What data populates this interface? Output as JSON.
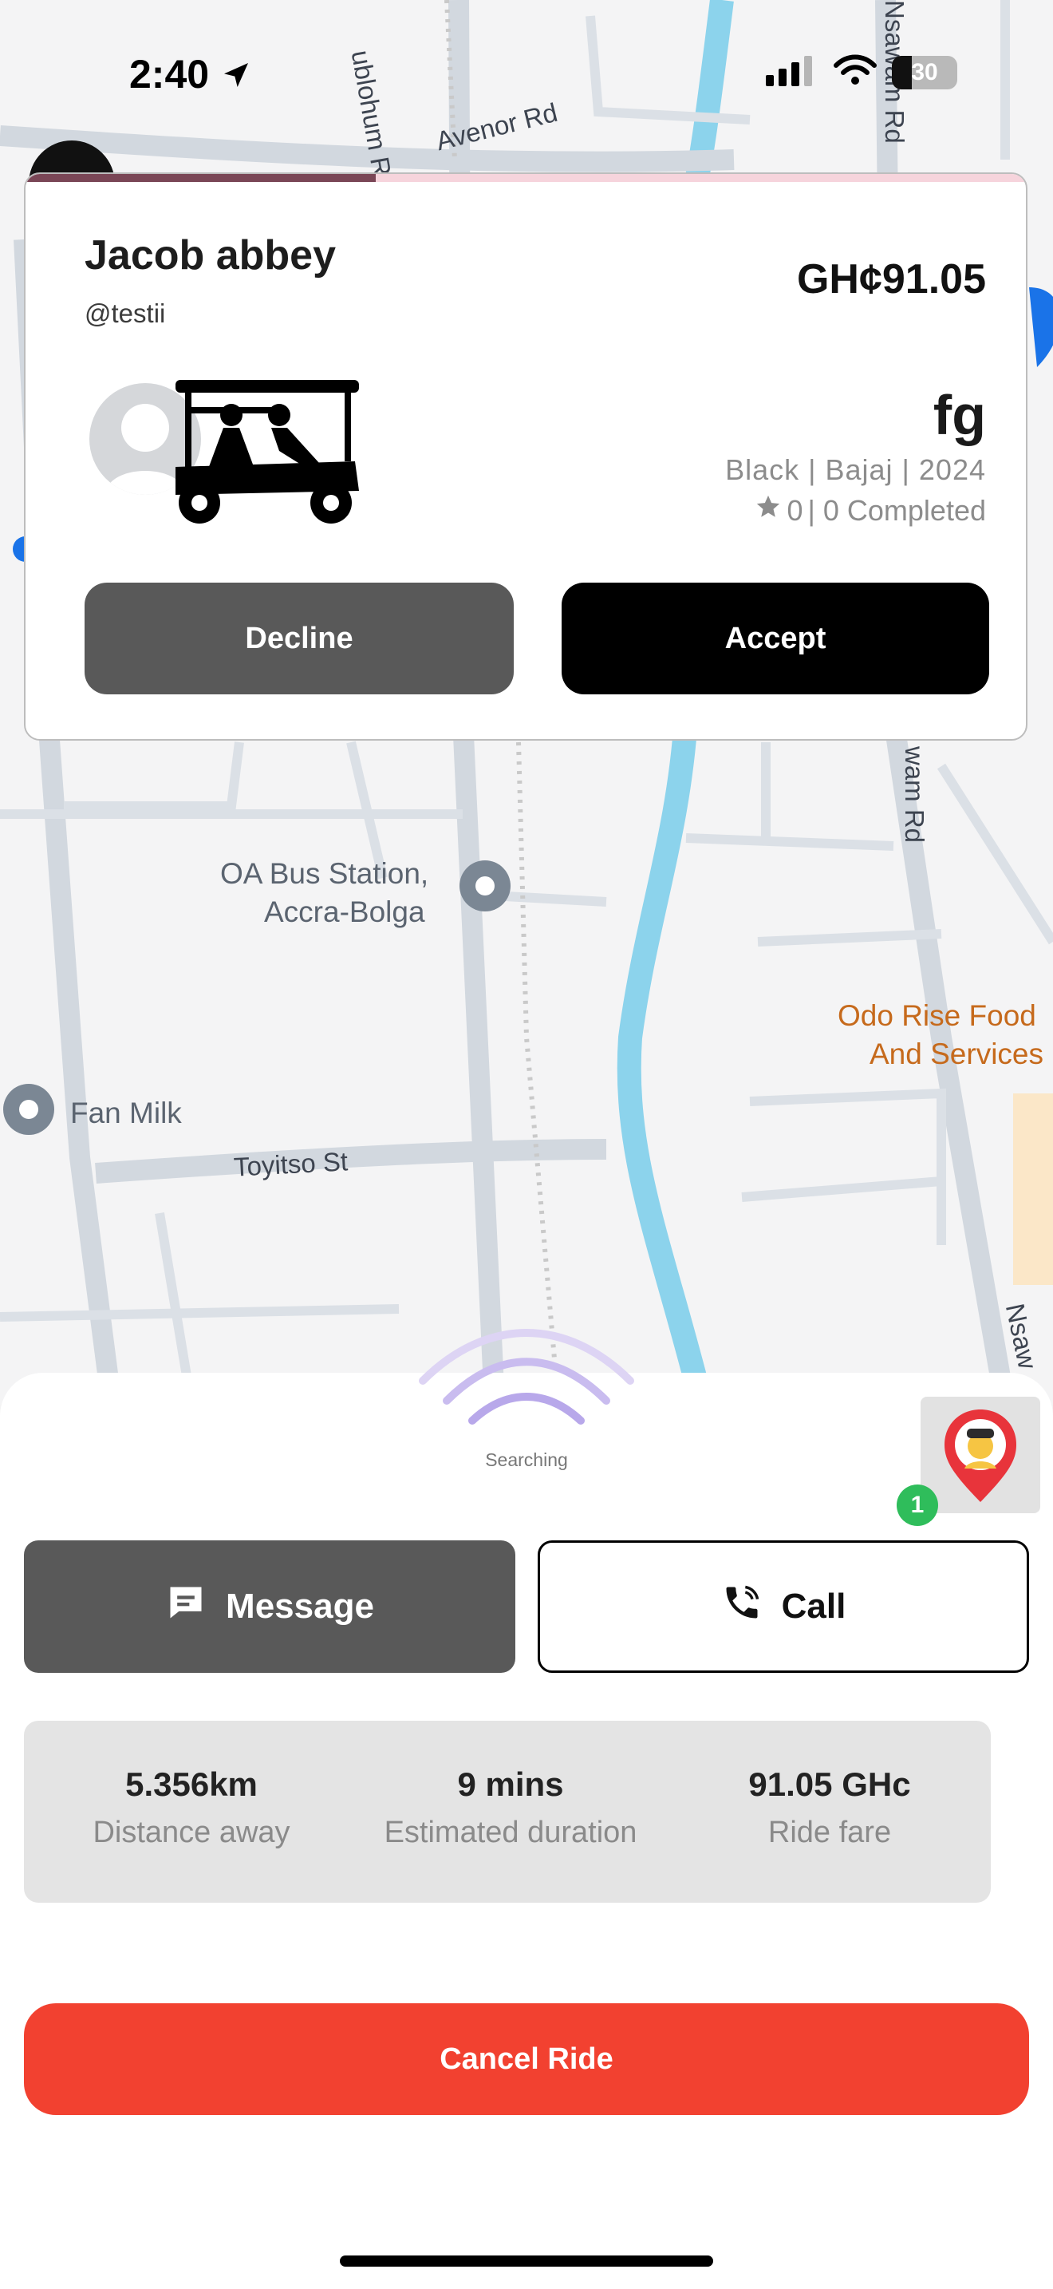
{
  "status_bar": {
    "time": "2:40",
    "battery": "30",
    "battery_level": 0.3,
    "icons": [
      "location-arrow-icon",
      "cellular-signal-icon",
      "wifi-icon",
      "battery-icon"
    ]
  },
  "map": {
    "road_labels": [
      "ublohum Rd",
      "Avenor Rd",
      "Nsawam Rd",
      "wam Rd",
      "Toyitso St",
      "Nsaw"
    ],
    "places": [
      "OA Bus Station,",
      "Accra-Bolga",
      "Fan Milk",
      "Odo Rise Food",
      "And Services"
    ],
    "colors": {
      "background": "#f4f4f5",
      "road": "#cfd6de",
      "river": "#8cd3ec",
      "rail": "#c9c9c9"
    }
  },
  "ride_request": {
    "rider_name": "Jacob abbey",
    "rider_handle": "@testii",
    "fare": "GH¢91.05",
    "vehicle_id": "fg",
    "vehicle_meta": "Black | Bajaj | 2024",
    "rating": "0",
    "completed": "| 0 Completed",
    "timer_remaining": 0.35,
    "decline_label": "Decline",
    "accept_label": "Accept"
  },
  "sheet": {
    "searching_label": "Searching",
    "marker_badge": "1",
    "message_label": "Message",
    "call_label": "Call",
    "stats": [
      {
        "value": "5.356km",
        "label": "Distance away"
      },
      {
        "value": "9 mins",
        "label": "Estimated duration"
      },
      {
        "value": "91.05 GHc",
        "label": "Ride fare"
      }
    ],
    "cancel_label": "Cancel Ride"
  },
  "colors": {
    "accent": "#f24130",
    "dark_button": "#595959",
    "primary_button": "#000000",
    "badge": "#2fbd5b"
  }
}
